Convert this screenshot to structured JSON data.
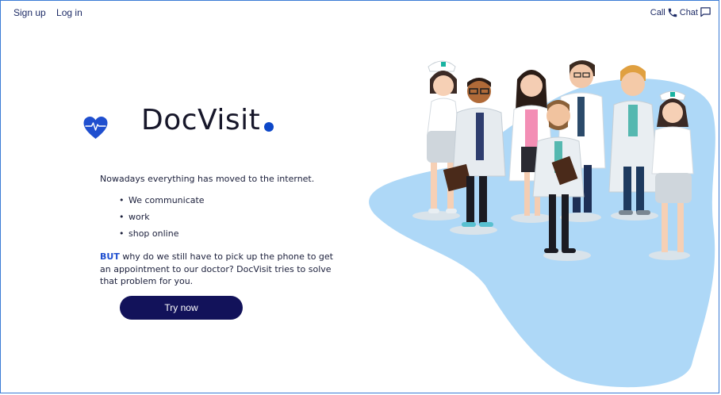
{
  "nav": {
    "signup": "Sign up",
    "login": "Log in",
    "call": "Call",
    "chat": "Chat",
    "icons": [
      "phone-icon",
      "chat-bubble-icon"
    ]
  },
  "brand": {
    "name": "DocVisit",
    "icon": "heart-pulse-icon",
    "accent": "#0d47c8"
  },
  "content": {
    "intro": "Nowadays everything has moved to the internet.",
    "bullets": [
      "We communicate",
      "work",
      "shop online"
    ],
    "but": "BUT",
    "paragraph": " why do we still have to pick up the phone to get an appointment to our doctor? DocVisit tries to solve that problem for you."
  },
  "cta": {
    "label": "Try now",
    "color": "#12125a"
  },
  "illustration": {
    "name": "medical-team-illustration",
    "blob_color": "#aed8f7"
  }
}
